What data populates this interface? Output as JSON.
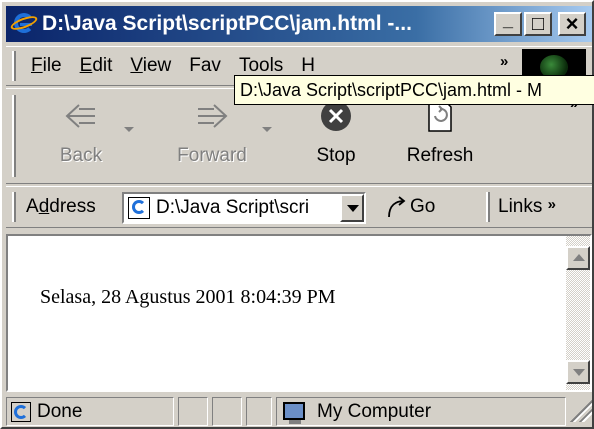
{
  "window": {
    "title": "D:\\Java Script\\scriptPCC\\jam.html -...",
    "min_label": "_",
    "max_label": "□",
    "close_label": "×"
  },
  "menubar": {
    "items": [
      {
        "label_ul": "F",
        "label_rest": "ile"
      },
      {
        "label_ul": "E",
        "label_rest": "dit"
      },
      {
        "label_ul": "V",
        "label_rest": "iew"
      },
      {
        "label_ul": "",
        "label_rest": "Fav"
      },
      {
        "label_ul": "",
        "label_rest": "Tools"
      },
      {
        "label_ul": "",
        "label_rest": "H"
      }
    ],
    "more": "»"
  },
  "tooltip": {
    "text": "D:\\Java Script\\scriptPCC\\jam.html - M"
  },
  "toolbar": {
    "back_label": "Back",
    "forward_label": "Forward",
    "stop_label": "Stop",
    "refresh_label": "Refresh",
    "more": "»"
  },
  "address": {
    "label_ul": "d",
    "label_pre": "A",
    "label_post": "dress",
    "value": "D:\\Java Script\\scri",
    "go_label": "Go",
    "links_label": "Links",
    "links_more": "»"
  },
  "content": {
    "text": "Selasa, 28 Agustus 2001 8:04:39 PM"
  },
  "status": {
    "state": "Done",
    "zone": "My Computer"
  },
  "colors": {
    "titlebar_start": "#0a246a",
    "titlebar_end": "#a6caf0",
    "tooltip_bg": "#ffffe1",
    "chrome": "#d4d0c8"
  }
}
